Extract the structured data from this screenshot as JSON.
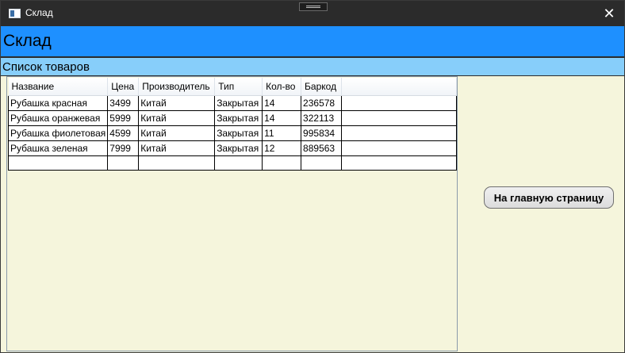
{
  "window": {
    "title": "Склад",
    "close_icon": "close-icon"
  },
  "header": {
    "title": "Склад"
  },
  "subheader": {
    "title": "Список товаров"
  },
  "grid": {
    "columns": [
      "Название",
      "Цена",
      "Производитель",
      "Тип",
      "Кол-во",
      "Баркод"
    ],
    "rows": [
      [
        "Рубашка красная",
        "3499",
        "Китай",
        "Закрытая",
        "14",
        "236578"
      ],
      [
        "Рубашка оранжевая",
        "5999",
        "Китай",
        "Закрытая",
        "14",
        "322113"
      ],
      [
        "Рубашка фиолетовая",
        "4599",
        "Китай",
        "Закрытая",
        "11",
        "995834"
      ],
      [
        "Рубашка зеленая",
        "7999",
        "Китай",
        "Закрытая",
        "12",
        "889563"
      ]
    ]
  },
  "buttons": {
    "main_page": "На главную страницу"
  },
  "colors": {
    "header": "#1e90ff",
    "subheader": "#87cefa",
    "content": "#f5f5dc",
    "titlebar": "#2b2b2b"
  }
}
